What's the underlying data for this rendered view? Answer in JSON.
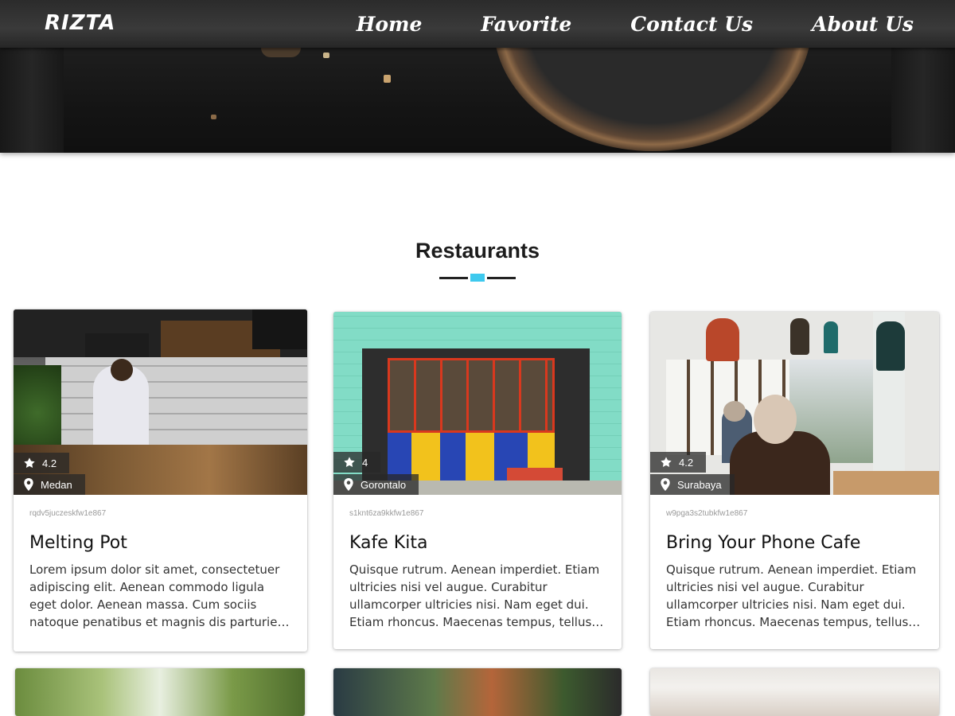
{
  "navbar": {
    "brand": "RIZTA",
    "links": [
      "Home",
      "Favorite",
      "Contact Us",
      "About Us"
    ]
  },
  "section": {
    "title": "Restaurants"
  },
  "colors": {
    "accent": "#3ec9ee",
    "navbar": "#333333",
    "text": "#1c1c1c"
  },
  "restaurants": [
    {
      "id": "rqdv5juczeskfw1e867",
      "name": "Melting Pot",
      "rating": "4.2",
      "city": "Medan",
      "description": "Lorem ipsum dolor sit amet, consectetuer adipiscing elit. Aenean commodo ligula eget dolor. Aenean massa. Cum sociis natoque penatibus et magnis dis parturient montes, nascetur ridiculus mus."
    },
    {
      "id": "s1knt6za9kkfw1e867",
      "name": "Kafe Kita",
      "rating": "4",
      "city": "Gorontalo",
      "description": "Quisque rutrum. Aenean imperdiet. Etiam ultricies nisi vel augue. Curabitur ullamcorper ultricies nisi. Nam eget dui. Etiam rhoncus. Maecenas tempus, tellus eget condimentum rhoncus."
    },
    {
      "id": "w9pga3s2tubkfw1e867",
      "name": "Bring Your Phone Cafe",
      "rating": "4.2",
      "city": "Surabaya",
      "description": "Quisque rutrum. Aenean imperdiet. Etiam ultricies nisi vel augue. Curabitur ullamcorper ultricies nisi. Nam eget dui. Etiam rhoncus. Maecenas tempus, tellus eget condimentum rhoncus."
    }
  ],
  "icons": {
    "star": "star-icon",
    "location": "location-pin-icon"
  }
}
